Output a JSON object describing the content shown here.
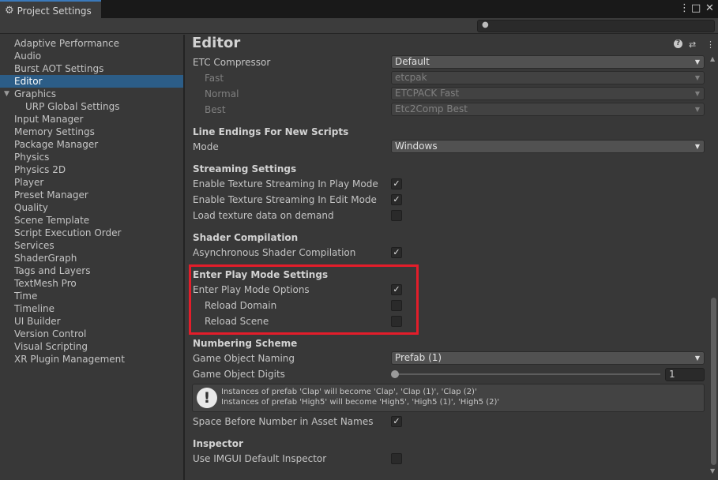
{
  "window": {
    "tab_title": "Project Settings",
    "tab_icon": "gear-icon"
  },
  "search": {
    "value": ""
  },
  "sidebar": {
    "items": [
      {
        "label": "Adaptive Performance"
      },
      {
        "label": "Audio"
      },
      {
        "label": "Burst AOT Settings"
      },
      {
        "label": "Editor",
        "selected": true
      },
      {
        "label": "Graphics",
        "expanded": true
      },
      {
        "label": "URP Global Settings",
        "child": true
      },
      {
        "label": "Input Manager"
      },
      {
        "label": "Memory Settings"
      },
      {
        "label": "Package Manager"
      },
      {
        "label": "Physics"
      },
      {
        "label": "Physics 2D"
      },
      {
        "label": "Player"
      },
      {
        "label": "Preset Manager"
      },
      {
        "label": "Quality"
      },
      {
        "label": "Scene Template"
      },
      {
        "label": "Script Execution Order"
      },
      {
        "label": "Services"
      },
      {
        "label": "ShaderGraph"
      },
      {
        "label": "Tags and Layers"
      },
      {
        "label": "TextMesh Pro"
      },
      {
        "label": "Time"
      },
      {
        "label": "Timeline"
      },
      {
        "label": "UI Builder"
      },
      {
        "label": "Version Control"
      },
      {
        "label": "Visual Scripting"
      },
      {
        "label": "XR Plugin Management"
      }
    ]
  },
  "editor": {
    "title": "Editor",
    "etc": {
      "compressor_label": "ETC Compressor",
      "compressor_value": "Default",
      "fast_label": "Fast",
      "fast_value": "etcpak",
      "normal_label": "Normal",
      "normal_value": "ETCPACK Fast",
      "best_label": "Best",
      "best_value": "Etc2Comp Best"
    },
    "line_endings": {
      "header": "Line Endings For New Scripts",
      "mode_label": "Mode",
      "mode_value": "Windows"
    },
    "streaming": {
      "header": "Streaming Settings",
      "play_mode_label": "Enable Texture Streaming In Play Mode",
      "play_mode_checked": true,
      "edit_mode_label": "Enable Texture Streaming In Edit Mode",
      "edit_mode_checked": true,
      "load_on_demand_label": "Load texture data on demand",
      "load_on_demand_checked": false
    },
    "shader": {
      "header": "Shader Compilation",
      "async_label": "Asynchronous Shader Compilation",
      "async_checked": true
    },
    "play_mode": {
      "header": "Enter Play Mode Settings",
      "options_label": "Enter Play Mode Options",
      "options_checked": true,
      "reload_domain_label": "Reload Domain",
      "reload_domain_checked": false,
      "reload_scene_label": "Reload Scene",
      "reload_scene_checked": false
    },
    "numbering": {
      "header": "Numbering Scheme",
      "naming_label": "Game Object Naming",
      "naming_value": "Prefab (1)",
      "digits_label": "Game Object Digits",
      "digits_value": "1",
      "digits_slider_fraction": 0,
      "help_line1": "Instances of prefab 'Clap' will become 'Clap', 'Clap (1)', 'Clap (2)'",
      "help_line2": "Instances of prefab 'High5' will become 'High5', 'High5 (1)', 'High5 (2)'",
      "space_label": "Space Before Number in Asset Names",
      "space_checked": true
    },
    "inspector": {
      "header": "Inspector",
      "imgui_label": "Use IMGUI Default Inspector",
      "imgui_checked": false
    }
  },
  "colors": {
    "selection": "#2c5d87",
    "highlight": "#e31d2a",
    "accent_tab": "#3a79bb"
  }
}
